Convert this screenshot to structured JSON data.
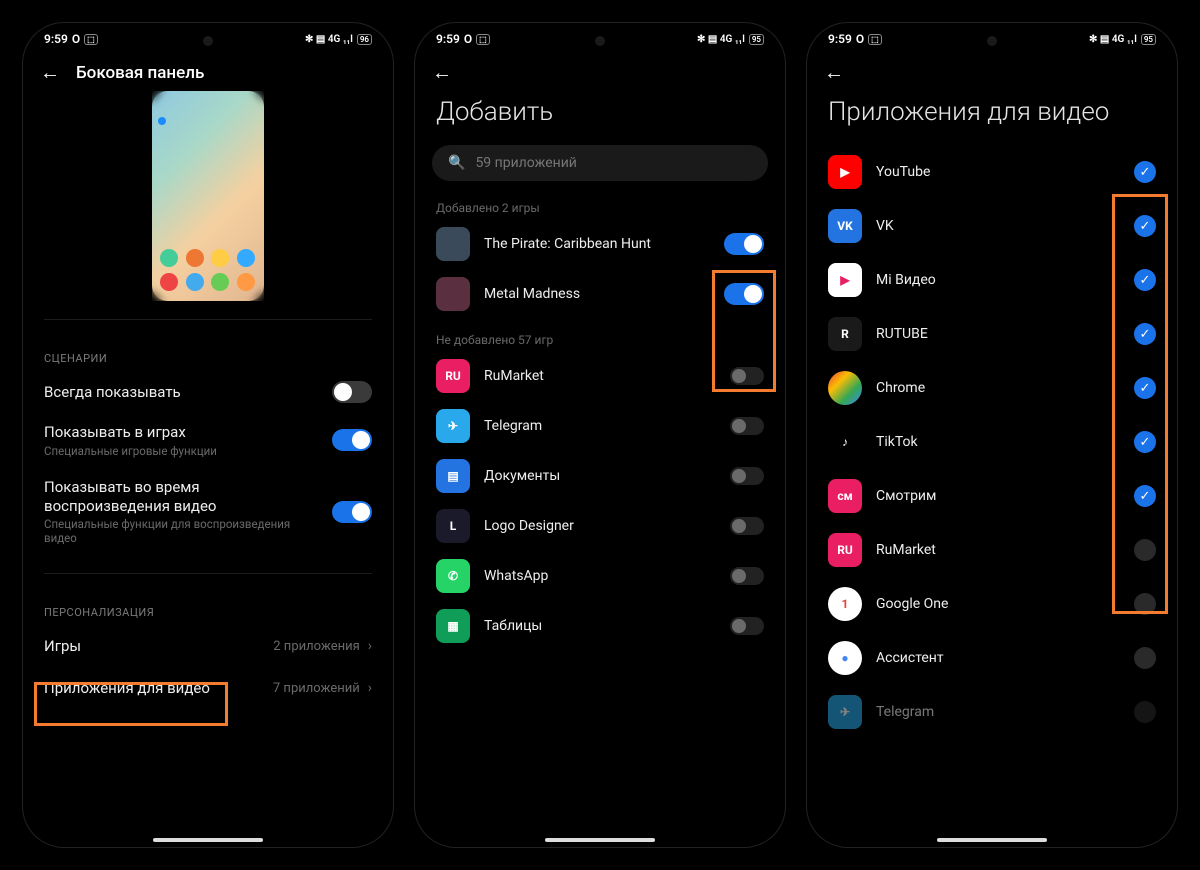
{
  "statusbar": {
    "time": "9:59",
    "icons_left": "O",
    "icons_right": "✻ ▤ 4G ₁₁l",
    "battery_left": "96",
    "battery_right": "95"
  },
  "screen1": {
    "title": "Боковая панель",
    "section_scenarios": "СЦЕНАРИИ",
    "row_always": "Всегда показывать",
    "row_games_title": "Показывать в играх",
    "row_games_sub": "Специальные игровые функции",
    "row_video_title": "Показывать во время воспроизведения видео",
    "row_video_sub": "Специальные функции для воспроизведения видео",
    "section_personal": "ПЕРСОНАЛИЗАЦИЯ",
    "nav_games": "Игры",
    "nav_games_value": "2 приложения",
    "nav_video": "Приложения для видео",
    "nav_video_value": "7 приложений"
  },
  "screen2": {
    "title": "Добавить",
    "search_placeholder": "59 приложений",
    "added_label": "Добавлено 2 игры",
    "added": [
      {
        "name": "The Pirate: Caribbean Hunt",
        "bg": "#3a4a5a"
      },
      {
        "name": "Metal Madness",
        "bg": "#5a3040"
      }
    ],
    "not_added_label": "Не добавлено 57 игр",
    "not_added": [
      {
        "name": "RuMarket",
        "bg": "#e91e63",
        "letter": "RU"
      },
      {
        "name": "Telegram",
        "bg": "#29a9eb",
        "letter": "✈"
      },
      {
        "name": "Документы",
        "bg": "#2374e1",
        "letter": "▤"
      },
      {
        "name": "Logo Designer",
        "bg": "#1a1a2a",
        "letter": "L"
      },
      {
        "name": "WhatsApp",
        "bg": "#25d366",
        "letter": "✆"
      },
      {
        "name": "Таблицы",
        "bg": "#0f9d58",
        "letter": "▦"
      }
    ]
  },
  "screen3": {
    "title": "Приложения для видео",
    "apps": [
      {
        "name": "YouTube",
        "bg": "#ff0000",
        "letter": "▶",
        "checked": true
      },
      {
        "name": "VK",
        "bg": "#2374e1",
        "letter": "VK",
        "checked": true
      },
      {
        "name": "Mi Видео",
        "bg": "#ffffff",
        "letter": "▶",
        "fg": "#e91e63",
        "checked": true
      },
      {
        "name": "RUTUBE",
        "bg": "#1a1a1a",
        "letter": "R",
        "checked": true
      },
      {
        "name": "Chrome",
        "bg": "linear-gradient(135deg,#ea4335 0%,#fbbc05 33%,#34a853 66%,#4285f4 100%)",
        "letter": "",
        "round": true,
        "checked": true
      },
      {
        "name": "TikTok",
        "bg": "#000000",
        "letter": "♪",
        "checked": true
      },
      {
        "name": "Смотрим",
        "bg": "#e91e63",
        "letter": "см",
        "checked": true
      },
      {
        "name": "RuMarket",
        "bg": "#e91e63",
        "letter": "RU",
        "checked": false
      },
      {
        "name": "Google One",
        "bg": "#ffffff",
        "letter": "1",
        "fg": "#ea4335",
        "round": true,
        "checked": false
      },
      {
        "name": "Ассистент",
        "bg": "#ffffff",
        "letter": "●",
        "fg": "#4285f4",
        "round": true,
        "checked": false
      },
      {
        "name": "Telegram",
        "bg": "#29a9eb",
        "letter": "✈",
        "checked": false,
        "dim": true
      }
    ]
  }
}
